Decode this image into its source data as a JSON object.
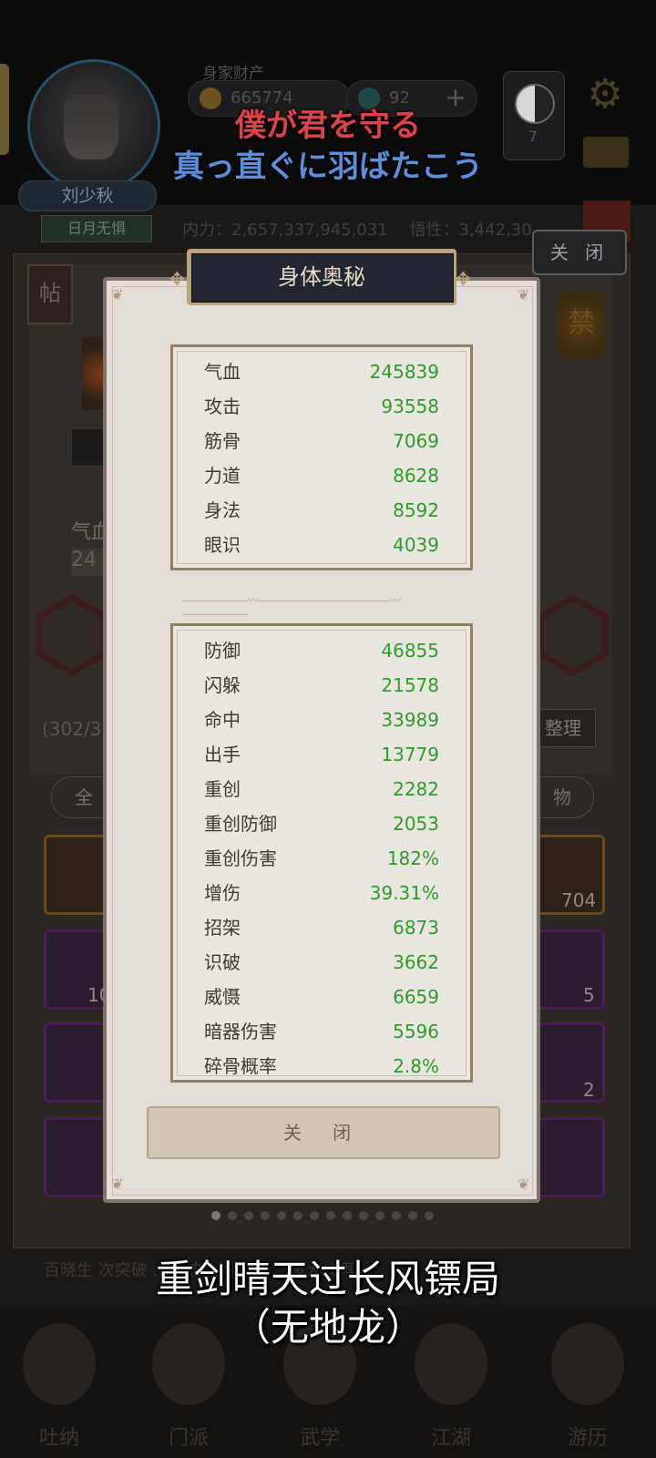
{
  "header": {
    "asset_label": "身家财产",
    "coins": "665774",
    "gems": "92",
    "plus": "+",
    "yinyang_count": "7",
    "player_name": "刘少秋",
    "player_title": "日月无惧",
    "power_text": "内力：2,657,337,945,031",
    "comprehension_text": "悟性：3,442,30",
    "close_label": "关 闭"
  },
  "panel": {
    "tie_label": "帖",
    "ban_label": "禁",
    "qi_label": "气血",
    "qi_value": "24",
    "count_text": "(302/31",
    "sort_label": "整理",
    "tab_all": "全",
    "tab_item": "物",
    "slot_counts": [
      "704",
      "10",
      "5",
      "2"
    ],
    "description": "百晓生 次突破 ……彼此间的 ……破大侠再"
  },
  "modal": {
    "title": "身体奥秘",
    "group1": [
      {
        "label": "气血",
        "value": "245839"
      },
      {
        "label": "攻击",
        "value": "93558"
      },
      {
        "label": "筋骨",
        "value": "7069"
      },
      {
        "label": "力道",
        "value": "8628"
      },
      {
        "label": "身法",
        "value": "8592"
      },
      {
        "label": "眼识",
        "value": "4039"
      }
    ],
    "group2": [
      {
        "label": "防御",
        "value": "46855"
      },
      {
        "label": "闪躲",
        "value": "21578"
      },
      {
        "label": "命中",
        "value": "33989"
      },
      {
        "label": "出手",
        "value": "13779"
      },
      {
        "label": "重创",
        "value": "2282"
      },
      {
        "label": "重创防御",
        "value": "2053"
      },
      {
        "label": "重创伤害",
        "value": "182%"
      },
      {
        "label": "增伤",
        "value": "39.31%"
      },
      {
        "label": "招架",
        "value": "6873"
      },
      {
        "label": "识破",
        "value": "3662"
      },
      {
        "label": "威慑",
        "value": "6659"
      },
      {
        "label": "暗器伤害",
        "value": "5596"
      },
      {
        "label": "碎骨概率",
        "value": "2.8%"
      }
    ],
    "close_label": "关 闭"
  },
  "bottom_nav": [
    {
      "label": "吐纳"
    },
    {
      "label": "门派"
    },
    {
      "label": "武学"
    },
    {
      "label": "江湖"
    },
    {
      "label": "游历"
    }
  ],
  "subtitles": {
    "jp_line1": "僕が君を守る",
    "jp_line2": "真っ直ぐに羽ばたこう",
    "cn_line1": "重剑晴天过长风镖局",
    "cn_line2": "（无地龙）"
  },
  "colors": {
    "stat_value": "#2e9c2a",
    "jp_line1": "#e0424a",
    "jp_line2": "#5c8fd8",
    "modal_bg": "#e2ddd6",
    "title_plate": "#232631"
  }
}
